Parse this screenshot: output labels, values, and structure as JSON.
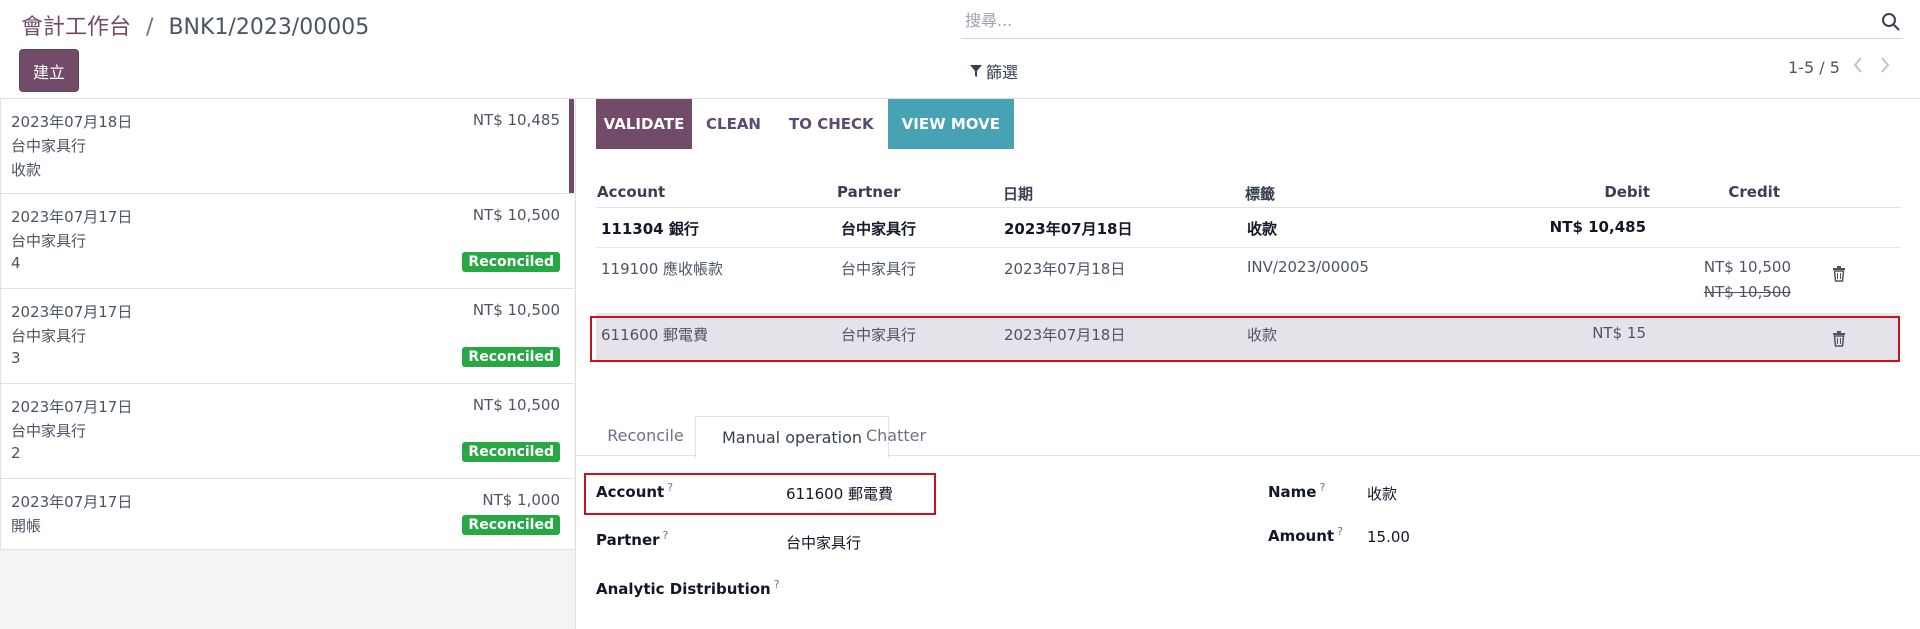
{
  "header": {
    "breadcrumb_root": "會計工作台",
    "breadcrumb_sep": "/",
    "breadcrumb_current": "BNK1/2023/00005",
    "create_label": "建立",
    "search_placeholder": "搜尋...",
    "filter_label": "篩選",
    "pager": "1-5 / 5"
  },
  "statements": [
    {
      "date": "2023年07月18日",
      "amount": "NT$ 10,485",
      "partner": "台中家具行",
      "ref": "收款",
      "badge": ""
    },
    {
      "date": "2023年07月17日",
      "amount": "NT$ 10,500",
      "partner": "台中家具行",
      "ref": "4",
      "badge": "Reconciled"
    },
    {
      "date": "2023年07月17日",
      "amount": "NT$ 10,500",
      "partner": "台中家具行",
      "ref": "3",
      "badge": "Reconciled"
    },
    {
      "date": "2023年07月17日",
      "amount": "NT$ 10,500",
      "partner": "台中家具行",
      "ref": "2",
      "badge": "Reconciled"
    },
    {
      "date": "2023年07月17日",
      "amount": "NT$ 1,000",
      "partner": "開帳",
      "ref": "",
      "badge": "Reconciled"
    }
  ],
  "actions": {
    "validate": "VALIDATE",
    "clean": "CLEAN",
    "to_check": "TO CHECK",
    "view_move": "VIEW MOVE"
  },
  "table": {
    "headers": {
      "account": "Account",
      "partner": "Partner",
      "date": "日期",
      "label": "標籤",
      "debit": "Debit",
      "credit": "Credit"
    },
    "rows": [
      {
        "account": "111304 銀行",
        "partner": "台中家具行",
        "date": "2023年07月18日",
        "label": "收款",
        "debit": "NT$ 10,485",
        "credit": "",
        "credit_struck": ""
      },
      {
        "account": "119100 應收帳款",
        "partner": "台中家具行",
        "date": "2023年07月18日",
        "label": "INV/2023/00005",
        "debit": "",
        "credit": "NT$ 10,500",
        "credit_struck": "NT$ 10,500"
      },
      {
        "account": "611600 郵電費",
        "partner": "台中家具行",
        "date": "2023年07月18日",
        "label": "收款",
        "debit": "NT$ 15",
        "credit": "",
        "credit_struck": ""
      }
    ]
  },
  "tabs": {
    "reconcile": "Reconcile",
    "manual": "Manual operation",
    "chatter": "Chatter"
  },
  "form": {
    "account_label": "Account",
    "account_value": "611600 郵電費",
    "partner_label": "Partner",
    "partner_value": "台中家具行",
    "analytic_label": "Analytic Distribution",
    "name_label": "Name",
    "name_value": "收款",
    "amount_label": "Amount",
    "amount_value": "15.00",
    "help_mark": "?"
  }
}
